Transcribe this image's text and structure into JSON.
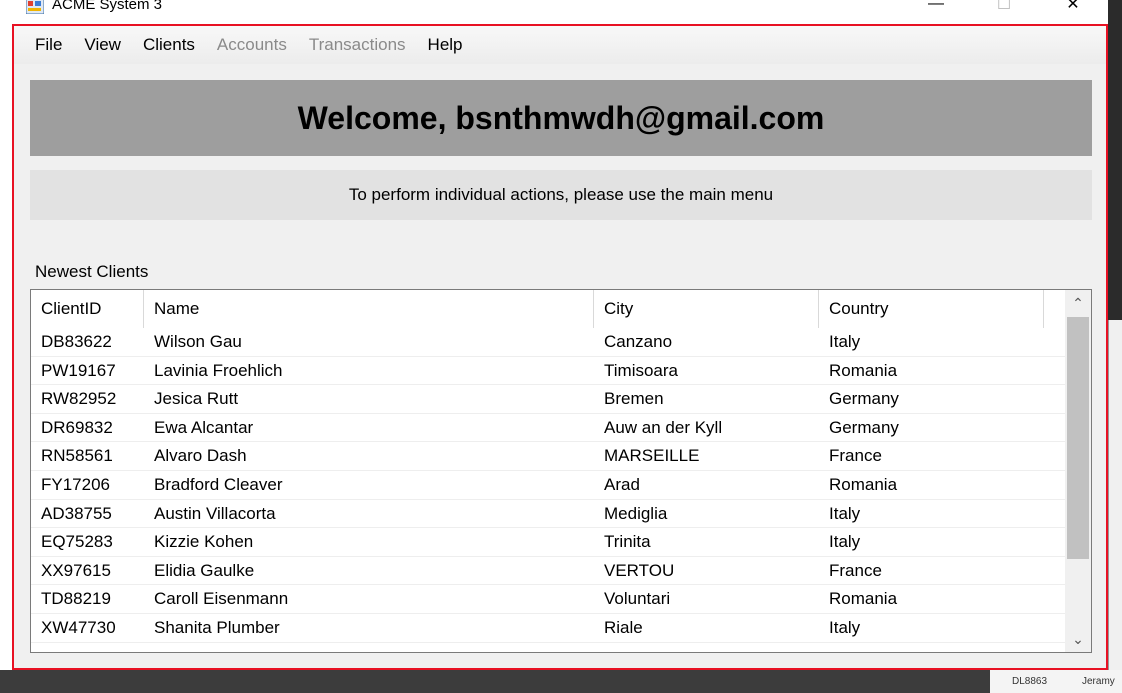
{
  "window": {
    "title": "ACME System 3",
    "minimize_glyph": "—",
    "maximize_glyph": "☐",
    "close_glyph": "✕"
  },
  "menu": {
    "items": [
      {
        "label": "File",
        "enabled": true
      },
      {
        "label": "View",
        "enabled": true
      },
      {
        "label": "Clients",
        "enabled": true
      },
      {
        "label": "Accounts",
        "enabled": false
      },
      {
        "label": "Transactions",
        "enabled": false
      },
      {
        "label": "Help",
        "enabled": true
      }
    ]
  },
  "welcome": {
    "text": "Welcome, bsnthmwdh@gmail.com"
  },
  "info": {
    "text": "To perform individual actions, please use the main menu"
  },
  "clients_section": {
    "label": "Newest Clients"
  },
  "grid": {
    "columns": [
      "ClientID",
      "Name",
      "City",
      "Country"
    ],
    "rows": [
      [
        "DB83622",
        "Wilson Gau",
        "Canzano",
        "Italy"
      ],
      [
        "PW19167",
        "Lavinia Froehlich",
        "Timisoara",
        "Romania"
      ],
      [
        "RW82952",
        "Jesica Rutt",
        "Bremen",
        "Germany"
      ],
      [
        "DR69832",
        "Ewa Alcantar",
        "Auw an der Kyll",
        "Germany"
      ],
      [
        "RN58561",
        "Alvaro Dash",
        "MARSEILLE",
        "France"
      ],
      [
        "FY17206",
        "Bradford Cleaver",
        "Arad",
        "Romania"
      ],
      [
        "AD38755",
        "Austin Villacorta",
        "Mediglia",
        "Italy"
      ],
      [
        "EQ75283",
        "Kizzie Kohen",
        "Trinita",
        "Italy"
      ],
      [
        "XX97615",
        "Elidia Gaulke",
        "VERTOU",
        "France"
      ],
      [
        "TD88219",
        "Caroll Eisenmann",
        "Voluntari",
        "Romania"
      ],
      [
        "XW47730",
        "Shanita Plumber",
        "Riale",
        "Italy"
      ]
    ],
    "scroll_up_glyph": "⌃",
    "scroll_down_glyph": "⌄"
  },
  "background": {
    "taskbar_text": [
      "DL8863",
      "Jeramy"
    ]
  },
  "colors": {
    "window_border": "#e81123",
    "welcome_bg": "#9e9e9e",
    "info_bg": "#e2e2e2",
    "disabled_menu": "#8a8a8a"
  }
}
